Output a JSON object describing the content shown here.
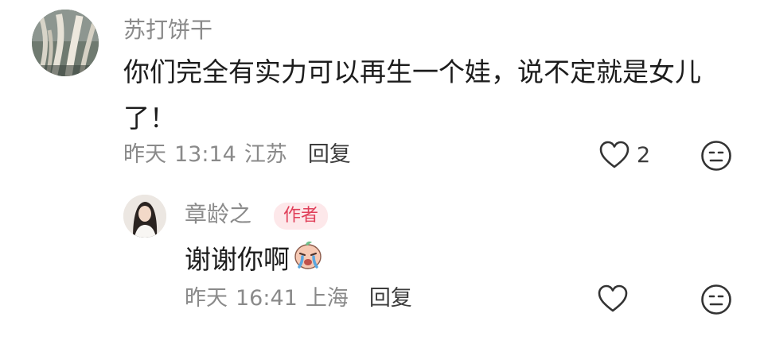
{
  "comment": {
    "author": "苏打饼干",
    "text": "你们完全有实力可以再生一个娃，说不定就是女儿了！",
    "date": "昨天",
    "time": "13:14",
    "location": "江苏",
    "reply_label": "回复",
    "like_count": "2",
    "icons": {
      "like": "heart-outline-icon",
      "dislike": "neutral-face-icon"
    }
  },
  "reply": {
    "author": "章龄之",
    "badge": "作者",
    "text": "谢谢你啊",
    "emoji": "crying-emoji",
    "date": "昨天",
    "time": "16:41",
    "location": "上海",
    "reply_label": "回复",
    "icons": {
      "like": "heart-outline-icon",
      "dislike": "neutral-face-icon"
    }
  },
  "colors": {
    "secondary_text": "#8a8a8a",
    "badge_bg": "#fde8ea",
    "badge_text": "#e0405a"
  }
}
